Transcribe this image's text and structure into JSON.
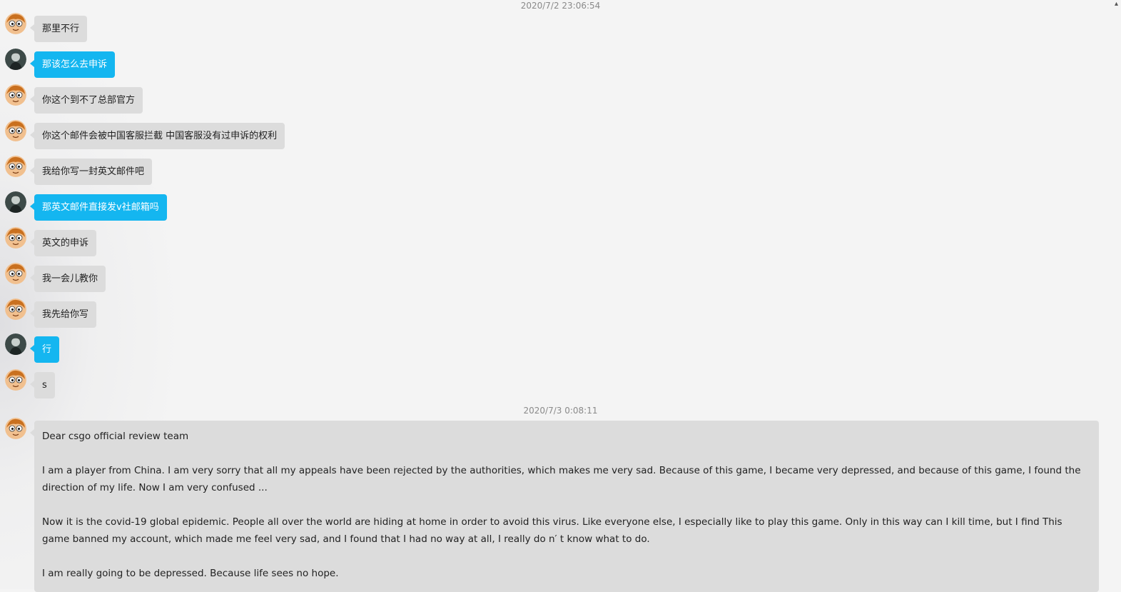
{
  "timestamps": [
    "2020/7/2 23:06:54",
    "2020/7/3 0:08:11"
  ],
  "messages": [
    {
      "text": "那里不行",
      "side": "other"
    },
    {
      "text": "那该怎么去申诉",
      "side": "me"
    },
    {
      "text": "你这个到不了总部官方",
      "side": "other"
    },
    {
      "text": "你这个邮件会被中国客服拦截 中国客服没有过申诉的权利",
      "side": "other"
    },
    {
      "text": "我给你写一封英文邮件吧",
      "side": "other"
    },
    {
      "text": "那英文邮件直接发v社邮箱吗",
      "side": "me"
    },
    {
      "text": "英文的申诉",
      "side": "other"
    },
    {
      "text": "我一会儿教你",
      "side": "other"
    },
    {
      "text": "我先给你写",
      "side": "other"
    },
    {
      "text": "行",
      "side": "me"
    },
    {
      "text": "s",
      "side": "other"
    }
  ],
  "long_message": {
    "paragraphs": [
      "Dear csgo official review team",
      "I am a player from China. I am very sorry that all my appeals have been rejected by the authorities, which makes me very sad. Because of this game, I became very depressed, and because of this game, I found the direction of my life. Now I am very confused ...",
      "Now it is the covid-19 global epidemic. People all over the world are hiding at home in order to avoid this virus. Like everyone else, I especially like to play this game. Only in this way can I kill time, but I find This game banned my account, which made me feel very sad, and I found that I had no way at all, I really do n′ t know what to do.",
      "I am really going to be depressed. Because life sees no hope."
    ]
  },
  "icons": {
    "other_avatar": "cartoon-face-avatar-icon",
    "me_avatar": "dark-character-avatar-icon"
  },
  "colors": {
    "other_bubble": "#dcdcdc",
    "me_bubble": "#14b6f0",
    "background": "#f4f4f4"
  }
}
